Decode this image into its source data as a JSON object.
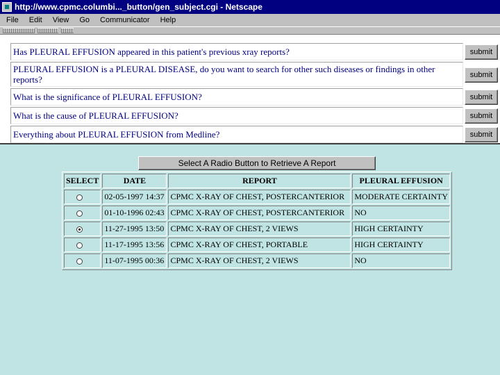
{
  "window": {
    "title": "http://www.cpmc.columbi..._button/gen_subject.cgi - Netscape"
  },
  "menu": [
    "File",
    "Edit",
    "View",
    "Go",
    "Communicator",
    "Help"
  ],
  "questions": [
    {
      "text": "Has PLEURAL EFFUSION appeared in this patient's previous xray reports?",
      "button": "submit"
    },
    {
      "text": "PLEURAL EFFUSION is a PLEURAL DISEASE, do you want to search for other such diseases or findings in other reports?",
      "button": "submit"
    },
    {
      "text": "What is the significance of PLEURAL EFFUSION?",
      "button": "submit"
    },
    {
      "text": "What is the cause of PLEURAL EFFUSION?",
      "button": "submit"
    },
    {
      "text": "Everything about PLEURAL EFFUSION from Medline?",
      "button": "submit"
    }
  ],
  "retrieve_button": "Select A Radio Button to Retrieve A Report",
  "report_table": {
    "headers": [
      "SELECT",
      "DATE",
      "REPORT",
      "PLEURAL EFFUSION"
    ],
    "rows": [
      {
        "selected": false,
        "date": "02-05-1997 14:37",
        "report": "CPMC X-RAY OF CHEST, POSTERCANTERIOR",
        "effusion": "MODERATE CERTAINTY"
      },
      {
        "selected": false,
        "date": "01-10-1996 02:43",
        "report": "CPMC X-RAY OF CHEST, POSTERCANTERIOR",
        "effusion": "NO"
      },
      {
        "selected": true,
        "date": "11-27-1995 13:50",
        "report": "CPMC X-RAY OF CHEST, 2 VIEWS",
        "effusion": "HIGH CERTAINTY"
      },
      {
        "selected": false,
        "date": "11-17-1995 13:56",
        "report": "CPMC X-RAY OF CHEST, PORTABLE",
        "effusion": "HIGH CERTAINTY"
      },
      {
        "selected": false,
        "date": "11-07-1995 00:36",
        "report": "CPMC X-RAY OF CHEST, 2 VIEWS",
        "effusion": "NO"
      }
    ]
  }
}
